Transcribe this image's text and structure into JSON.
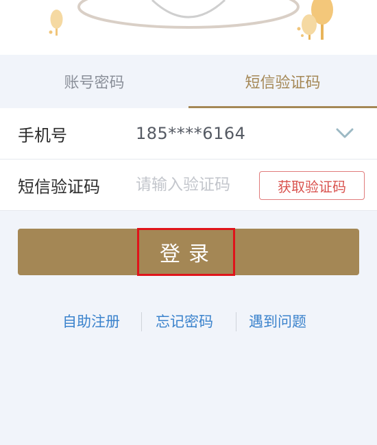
{
  "tabs": [
    {
      "label": "账号密码",
      "active": false
    },
    {
      "label": "短信验证码",
      "active": true
    }
  ],
  "form": {
    "phone": {
      "label": "手机号",
      "value": "185****6164",
      "dropdown_icon": "chevron-down-icon"
    },
    "sms_code": {
      "label": "短信验证码",
      "placeholder": "请输入验证码",
      "get_code_label": "获取验证码"
    }
  },
  "login": {
    "label": "登录"
  },
  "links": [
    {
      "label": "自助注册"
    },
    {
      "label": "忘记密码"
    },
    {
      "label": "遇到问题"
    }
  ],
  "colors": {
    "accent": "#a48755",
    "link": "#3a82cc",
    "danger": "#d9534f",
    "highlight": "#e0131a"
  }
}
